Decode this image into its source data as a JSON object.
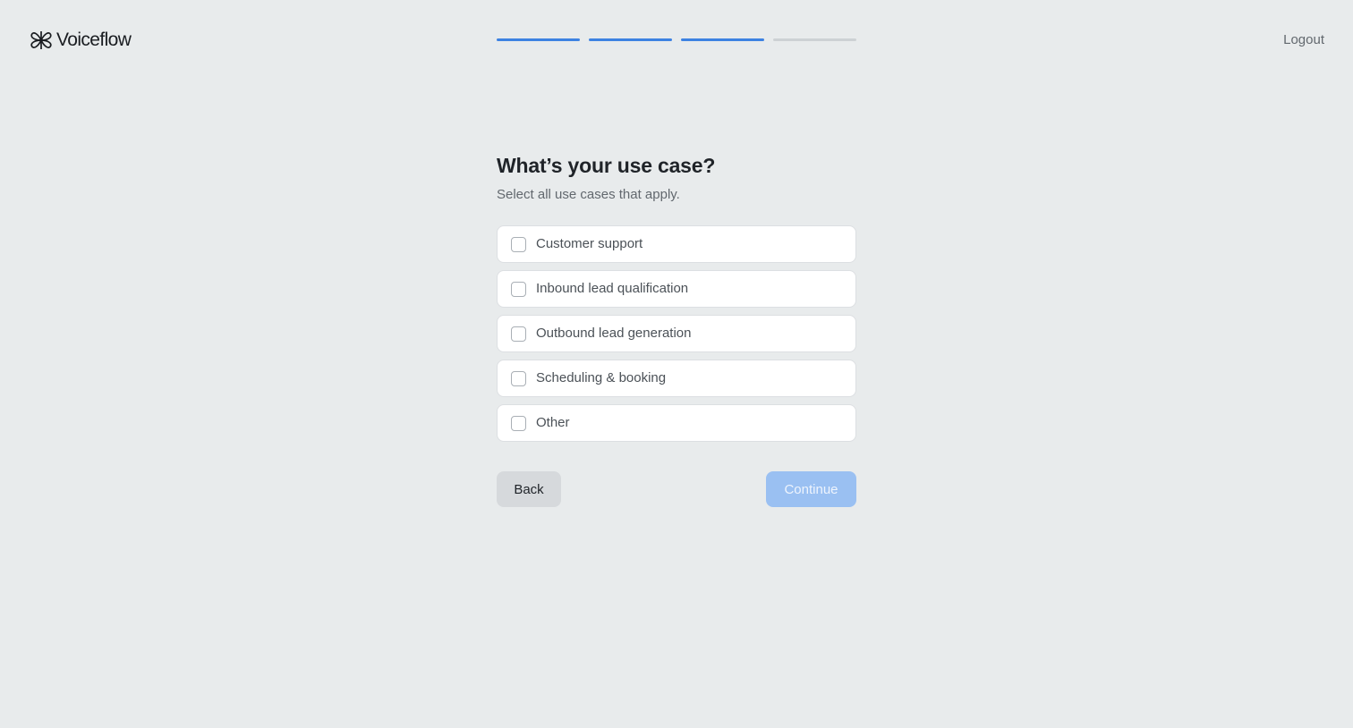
{
  "header": {
    "logo_text": "Voiceflow",
    "logo_icon": "voiceflow-logo-icon",
    "progress": {
      "total_steps": 4,
      "completed_steps": 3
    },
    "logout_label": "Logout"
  },
  "main": {
    "title": "What’s your use case?",
    "subtitle": "Select all use cases that apply.",
    "options": [
      {
        "label": "Customer support",
        "checked": false
      },
      {
        "label": "Inbound lead qualification",
        "checked": false
      },
      {
        "label": "Outbound lead generation",
        "checked": false
      },
      {
        "label": "Scheduling & booking",
        "checked": false
      },
      {
        "label": "Other",
        "checked": false
      }
    ],
    "back_label": "Back",
    "continue_label": "Continue",
    "continue_disabled": true
  },
  "colors": {
    "background": "#e8ebec",
    "accent": "#3d82e2",
    "accent_disabled": "#9ac0f2"
  }
}
